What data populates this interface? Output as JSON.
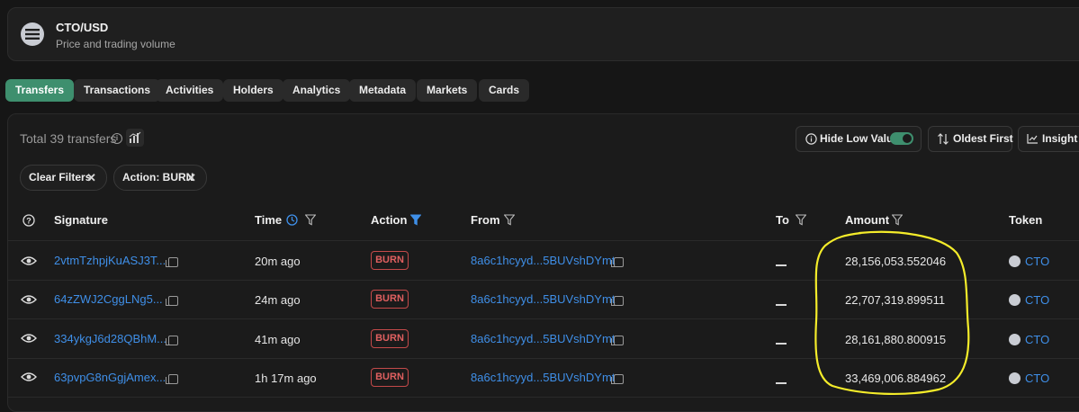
{
  "header": {
    "pair": "CTO/USD",
    "subtitle": "Price and trading volume",
    "logo_icon": "solana-icon"
  },
  "tabs": [
    {
      "label": "Transfers",
      "active": true
    },
    {
      "label": "Transactions",
      "active": false
    },
    {
      "label": "Activities",
      "active": false
    },
    {
      "label": "Holders",
      "active": false
    },
    {
      "label": "Analytics",
      "active": false
    },
    {
      "label": "Metadata",
      "active": false
    },
    {
      "label": "Markets",
      "active": false
    },
    {
      "label": "Cards",
      "active": false
    }
  ],
  "toolbar": {
    "total_label": "Total 39 transfers",
    "hide_low_value_label": "Hide Low Value",
    "hide_low_value_on": true,
    "sort_label": "Oldest First",
    "insight_label": "Insight"
  },
  "filters": {
    "clear_label": "Clear Filters",
    "action_label": "Action: BURN"
  },
  "columns": {
    "signature": "Signature",
    "time": "Time",
    "action": "Action",
    "from": "From",
    "to": "To",
    "amount": "Amount",
    "token": "Token"
  },
  "rows": [
    {
      "signature": "2vtmTzhpjKuASJ3T...",
      "time": "20m ago",
      "action": "BURN",
      "from": "8a6c1hcyyd...5BUVshDYmt",
      "to": "—",
      "amount": "28,156,053.552046",
      "token": "CTO"
    },
    {
      "signature": "64zZWJ2CggLNg5...",
      "time": "24m ago",
      "action": "BURN",
      "from": "8a6c1hcyyd...5BUVshDYmt",
      "to": "—",
      "amount": "22,707,319.899511",
      "token": "CTO"
    },
    {
      "signature": "334ykgJ6d28QBhM...",
      "time": "41m ago",
      "action": "BURN",
      "from": "8a6c1hcyyd...5BUVshDYmt",
      "to": "—",
      "amount": "28,161,880.800915",
      "token": "CTO"
    },
    {
      "signature": "63pvpG8nGgjAmex...",
      "time": "1h 17m ago",
      "action": "BURN",
      "from": "8a6c1hcyyd...5BUVshDYmt",
      "to": "—",
      "amount": "33,469,006.884962",
      "token": "CTO"
    }
  ],
  "colors": {
    "accent": "#3e8f6e",
    "link": "#3f8fe8",
    "burn": "#e06060",
    "highlight_circle": "#f4ec2a"
  }
}
